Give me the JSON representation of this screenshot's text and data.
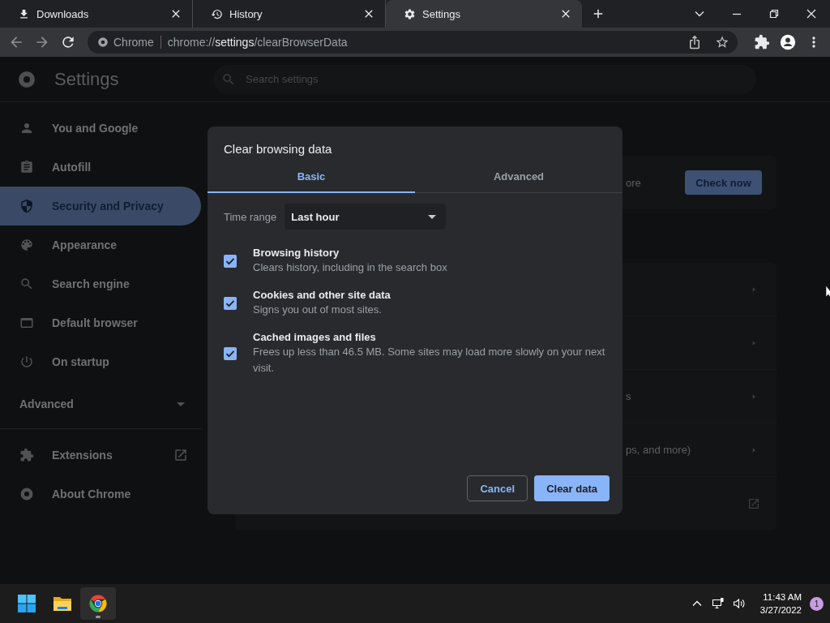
{
  "browser": {
    "tabs": [
      {
        "title": "Downloads",
        "kind": "download",
        "selected": false
      },
      {
        "title": "History",
        "kind": "history",
        "selected": false
      },
      {
        "title": "Settings",
        "kind": "gear",
        "selected": true
      }
    ],
    "address": {
      "site_label": "Chrome",
      "url_scheme": "chrome://",
      "url_host": "settings",
      "url_path": "/clearBrowserData"
    }
  },
  "settings": {
    "title": "Settings",
    "search": {
      "placeholder": "Search settings"
    },
    "sidebar": {
      "items": [
        {
          "label": "You and Google",
          "kind": "person",
          "selected": false
        },
        {
          "label": "Autofill",
          "kind": "clipboard",
          "selected": false
        },
        {
          "label": "Security and Privacy",
          "kind": "shield",
          "selected": true
        },
        {
          "label": "Appearance",
          "kind": "palette",
          "selected": false
        },
        {
          "label": "Search engine",
          "kind": "search",
          "selected": false
        },
        {
          "label": "Default browser",
          "kind": "window",
          "selected": false
        },
        {
          "label": "On startup",
          "kind": "power",
          "selected": false
        }
      ],
      "advanced": {
        "label": "Advanced",
        "expanded": false
      },
      "footer_items": [
        {
          "label": "Extensions",
          "kind": "puzzle",
          "external": true
        },
        {
          "label": "About Chrome",
          "kind": "chrome",
          "external": false
        }
      ]
    },
    "safety_check": {
      "text": "ore",
      "button": "Check now"
    },
    "privacy_rows": [
      {
        "kind": "chevron"
      },
      {
        "kind": "chevron"
      },
      {
        "kind": "chevron",
        "text": "s"
      },
      {
        "kind": "chevron",
        "text": "ps, and more)"
      },
      {
        "kind": "external"
      }
    ]
  },
  "dialog": {
    "title": "Clear browsing data",
    "tabs": [
      {
        "label": "Basic",
        "selected": true
      },
      {
        "label": "Advanced",
        "selected": false
      }
    ],
    "time_range": {
      "label": "Time range",
      "value": "Last hour"
    },
    "options": [
      {
        "title": "Browsing history",
        "description": "Clears history, including in the search box",
        "checked": true
      },
      {
        "title": "Cookies and other site data",
        "description": "Signs you out of most sites.",
        "checked": true
      },
      {
        "title": "Cached images and files",
        "description": "Frees up less than 46.5 MB. Some sites may load more slowly on your next visit.",
        "checked": true
      }
    ],
    "buttons": {
      "cancel": "Cancel",
      "confirm": "Clear data"
    }
  },
  "taskbar": {
    "apps": [
      {
        "kind": "start",
        "active": false
      },
      {
        "kind": "folder",
        "active": false
      },
      {
        "kind": "chrome",
        "active": true
      }
    ],
    "time": "11:43 AM",
    "date": "3/27/2022",
    "notification_count": "1"
  }
}
